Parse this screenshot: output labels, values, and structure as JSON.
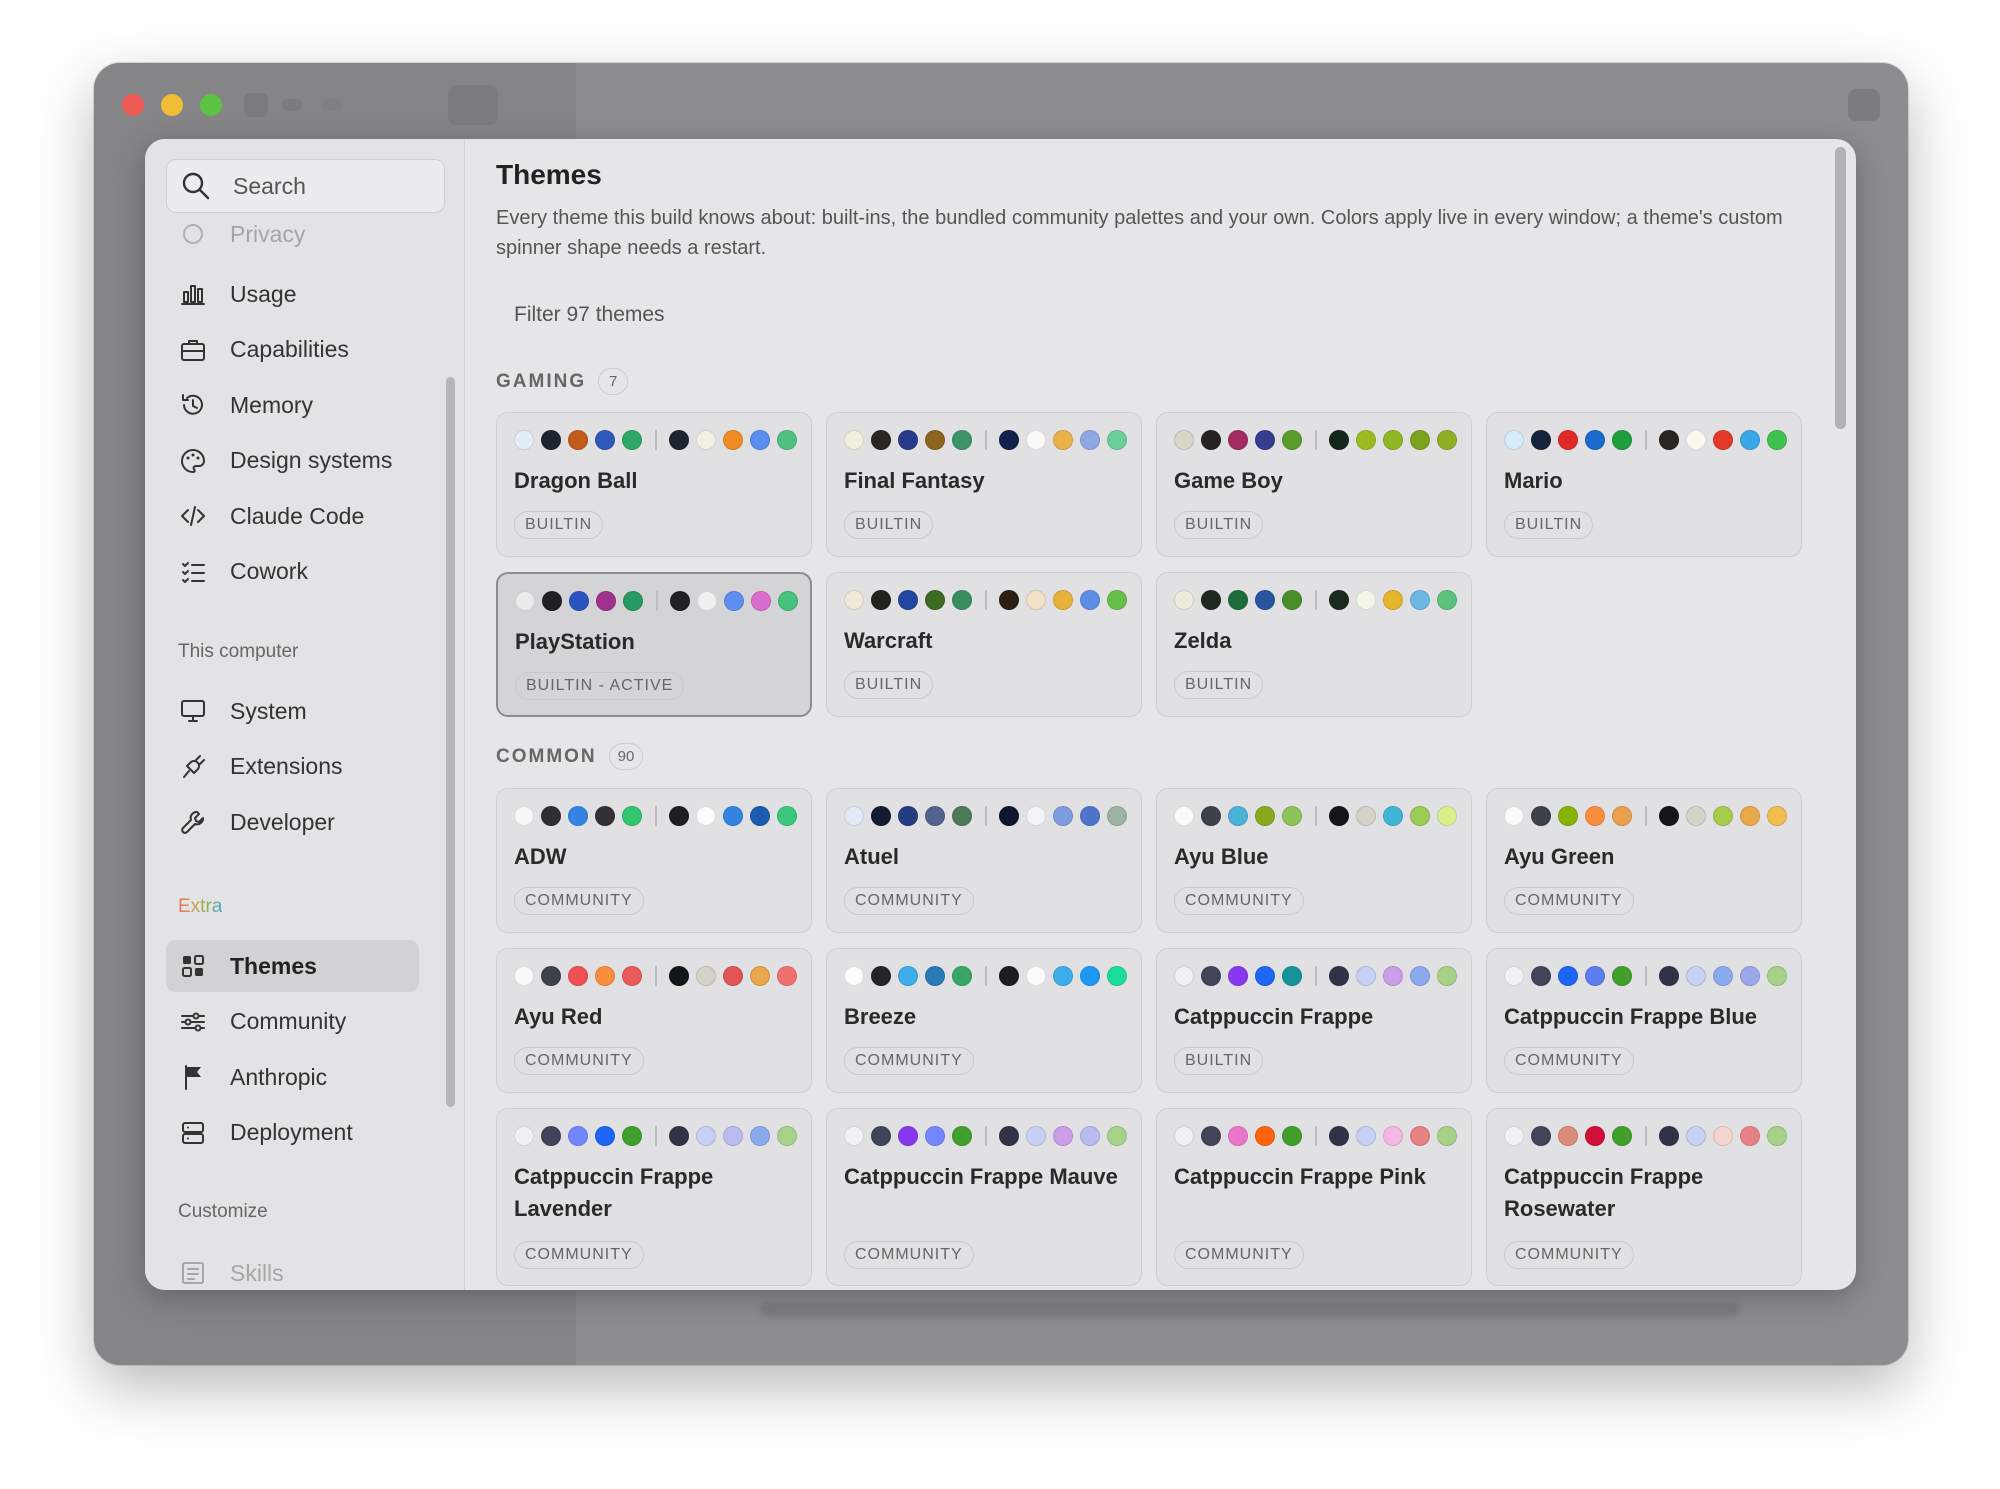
{
  "sidebar": {
    "search_placeholder": "Search",
    "faded_top": "Privacy",
    "items_a": [
      {
        "label": "Usage",
        "icon": "bar-chart-icon"
      },
      {
        "label": "Capabilities",
        "icon": "briefcase-icon"
      },
      {
        "label": "Memory",
        "icon": "history-icon"
      },
      {
        "label": "Design systems",
        "icon": "palette-icon"
      },
      {
        "label": "Claude Code",
        "icon": "code-icon"
      },
      {
        "label": "Cowork",
        "icon": "checklist-icon"
      }
    ],
    "section_computer": "This computer",
    "items_b": [
      {
        "label": "System",
        "icon": "monitor-icon"
      },
      {
        "label": "Extensions",
        "icon": "plug-icon"
      },
      {
        "label": "Developer",
        "icon": "wrench-icon"
      }
    ],
    "section_extra": "Extra",
    "items_c": [
      {
        "label": "Themes",
        "icon": "grid-icon",
        "active": true
      },
      {
        "label": "Community",
        "icon": "sliders-icon"
      },
      {
        "label": "Anthropic",
        "icon": "flag-icon"
      },
      {
        "label": "Deployment",
        "icon": "server-icon"
      }
    ],
    "section_customize": "Customize",
    "items_d": [
      {
        "label": "Skills",
        "icon": "skills-icon"
      }
    ]
  },
  "main": {
    "title": "Themes",
    "description": "Every theme this build knows about: built-ins, the bundled community palettes and your own. Colors apply live in every window; a theme's custom spinner shape needs a restart.",
    "filter_placeholder": "Filter 97 themes",
    "groups": [
      {
        "name": "GAMING",
        "count": "7",
        "themes": [
          {
            "name": "Dragon Ball",
            "badge": "BUILTIN",
            "left": [
              "#e4ecf7",
              "#1f2530",
              "#c25a1a",
              "#2f59b8",
              "#2fa866"
            ],
            "right": [
              "#1f2530",
              "#f3efe4",
              "#f08c24",
              "#5a8ef0",
              "#4fc07f"
            ]
          },
          {
            "name": "Final Fantasy",
            "badge": "BUILTIN",
            "left": [
              "#f2eddc",
              "#2a2620",
              "#283a8c",
              "#8b6420",
              "#3d9466"
            ],
            "right": [
              "#12224a",
              "#fbfbfb",
              "#e9b24b",
              "#8fa7e3",
              "#6ccf98"
            ]
          },
          {
            "name": "Game Boy",
            "badge": "BUILTIN",
            "left": [
              "#d9d5c8",
              "#252320",
              "#a42b60",
              "#363c8e",
              "#5a9b2a"
            ],
            "right": [
              "#15261a",
              "#9cbb1f",
              "#8eb722",
              "#7aa320",
              "#8fb024"
            ]
          },
          {
            "name": "Mario",
            "badge": "BUILTIN",
            "left": [
              "#d7ecfa",
              "#17223b",
              "#e02b28",
              "#1a6ad0",
              "#1f9e3d"
            ],
            "right": [
              "#2b2420",
              "#fbf7ef",
              "#e23a27",
              "#3aa8e6",
              "#3fc04f"
            ]
          },
          {
            "name": "PlayStation",
            "badge": "BUILTIN - ACTIVE",
            "active": true,
            "left": [
              "#ebebeb",
              "#1e2026",
              "#2a55c0",
              "#a0318d",
              "#269a62"
            ],
            "right": [
              "#1f2127",
              "#f0f0f0",
              "#5f8df0",
              "#d96ccf",
              "#47c17b"
            ]
          },
          {
            "name": "Warcraft",
            "badge": "BUILTIN",
            "left": [
              "#efe8d7",
              "#24221d",
              "#2546a0",
              "#3c6b23",
              "#368e5e"
            ],
            "right": [
              "#2a2016",
              "#f2e1c6",
              "#e7b23a",
              "#5d8ee3",
              "#67c04b"
            ]
          },
          {
            "name": "Zelda",
            "badge": "BUILTIN",
            "left": [
              "#ecebdb",
              "#1e2a1f",
              "#1e6e3c",
              "#2b54a0",
              "#4b8f2a"
            ],
            "right": [
              "#1b2a1e",
              "#f4f6ea",
              "#e6b42a",
              "#6bb8e3",
              "#5cc27d"
            ]
          }
        ]
      },
      {
        "name": "COMMON",
        "count": "90",
        "themes": [
          {
            "name": "ADW",
            "badge": "COMMUNITY",
            "left": [
              "#f7f7f7",
              "#2f2f31",
              "#3584e4",
              "#323234",
              "#33c46e"
            ],
            "right": [
              "#1e1e20",
              "#fbfbfb",
              "#3584e4",
              "#1c5bb0",
              "#3ac97a"
            ]
          },
          {
            "name": "Atuel",
            "badge": "COMMUNITY",
            "left": [
              "#e3eaf7",
              "#141a30",
              "#263c80",
              "#52648e",
              "#4f7a5a"
            ],
            "right": [
              "#0f1530",
              "#f1f3f8",
              "#7e9ce0",
              "#4f74cc",
              "#9db4a4"
            ]
          },
          {
            "name": "Ayu Blue",
            "badge": "COMMUNITY",
            "left": [
              "#fafafa",
              "#3d4248",
              "#4ab3d7",
              "#8aa81c",
              "#8ec25a"
            ],
            "right": [
              "#12151a",
              "#d5d3c9",
              "#40b5d8",
              "#9ccc56",
              "#d9f08a"
            ]
          },
          {
            "name": "Ayu Green",
            "badge": "COMMUNITY",
            "left": [
              "#fafafa",
              "#3d4248",
              "#86b300",
              "#fa8d3e",
              "#e8a04c"
            ],
            "right": [
              "#12151a",
              "#d5d3c9",
              "#a6cc4c",
              "#e8a84a",
              "#f3be4e"
            ]
          },
          {
            "name": "Ayu Red",
            "badge": "COMMUNITY",
            "left": [
              "#fafafa",
              "#3d4248",
              "#f05050",
              "#fa8d3e",
              "#ec5b5b"
            ],
            "right": [
              "#12151a",
              "#d5d3c9",
              "#e05656",
              "#eba54c",
              "#f07070"
            ]
          },
          {
            "name": "Breeze",
            "badge": "COMMUNITY",
            "left": [
              "#fcfcfc",
              "#232629",
              "#3daee9",
              "#2b7ab5",
              "#38a666"
            ],
            "right": [
              "#1b1e20",
              "#fcfcfc",
              "#3daee9",
              "#1d99f3",
              "#1cdc9a"
            ]
          },
          {
            "name": "Catppuccin Frappe",
            "badge": "BUILTIN",
            "left": [
              "#eff1f5",
              "#414559",
              "#8839ef",
              "#1e66f5",
              "#179299"
            ],
            "right": [
              "#303446",
              "#c6d0f5",
              "#ca9ee6",
              "#8caaee",
              "#a6d189"
            ]
          },
          {
            "name": "Catppuccin Frappe Blue",
            "badge": "COMMUNITY",
            "left": [
              "#eff1f5",
              "#414559",
              "#1e66f5",
              "#5c7df0",
              "#40a02b"
            ],
            "right": [
              "#303446",
              "#c6d0f5",
              "#8caaee",
              "#99a8e8",
              "#a6d189"
            ]
          },
          {
            "name": "Catppuccin Frappe Lavender",
            "badge": "COMMUNITY",
            "left": [
              "#eff1f5",
              "#414559",
              "#7287fd",
              "#1e66f5",
              "#40a02b"
            ],
            "right": [
              "#303446",
              "#c6d0f5",
              "#babbf1",
              "#8caaee",
              "#a6d189"
            ]
          },
          {
            "name": "Catppuccin Frappe Mauve",
            "badge": "COMMUNITY",
            "left": [
              "#eff1f5",
              "#414559",
              "#8839ef",
              "#7287fd",
              "#40a02b"
            ],
            "right": [
              "#303446",
              "#c6d0f5",
              "#ca9ee6",
              "#babbf1",
              "#a6d189"
            ]
          },
          {
            "name": "Catppuccin Frappe Pink",
            "badge": "COMMUNITY",
            "left": [
              "#eff1f5",
              "#414559",
              "#ea76cb",
              "#fe640b",
              "#40a02b"
            ],
            "right": [
              "#303446",
              "#c6d0f5",
              "#f4b8e4",
              "#e78284",
              "#a6d189"
            ]
          },
          {
            "name": "Catppuccin Frappe Rosewater",
            "badge": "COMMUNITY",
            "left": [
              "#eff1f5",
              "#414559",
              "#dc8a78",
              "#d20f39",
              "#40a02b"
            ],
            "right": [
              "#303446",
              "#c6d0f5",
              "#f2d5cf",
              "#e78284",
              "#a6d189"
            ]
          }
        ]
      }
    ]
  }
}
